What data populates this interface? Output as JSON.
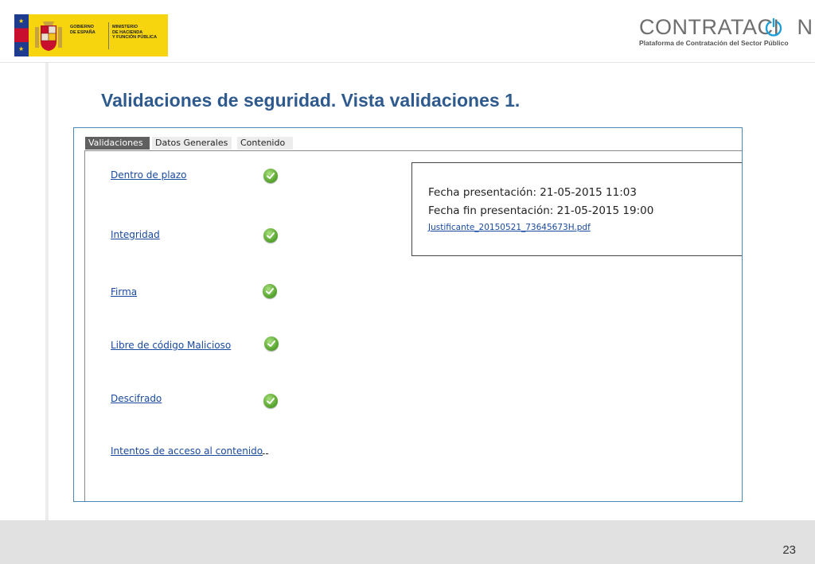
{
  "header": {
    "gov_logo": {
      "line1": "GOBIERNO",
      "line2": "DE ESPAÑA",
      "ministry1": "MINISTERIO",
      "ministry2": "DE HACIENDA",
      "ministry3": "Y FUNCIÓN PÚBLICA"
    },
    "brand": {
      "word": "CONTRATACI",
      "word_end": "N",
      "subtitle": "Plataforma de Contratación del Sector Público",
      "power_icon_color": "#1fa0d8"
    }
  },
  "page_title": "Validaciones de seguridad. Vista validaciones 1.",
  "tabs": [
    {
      "label": "Validaciones",
      "active": true
    },
    {
      "label": "Datos Generales",
      "active": false
    },
    {
      "label": "Contenido",
      "active": false
    }
  ],
  "validations": [
    {
      "label": "Dentro de plazo",
      "status": "check-icon"
    },
    {
      "label": "Integridad",
      "status": "check-icon"
    },
    {
      "label": "Firma",
      "status": "check-icon"
    },
    {
      "label": "Libre de código Malicioso",
      "status": "check-icon"
    },
    {
      "label": "Descifrado",
      "status": "check-icon"
    },
    {
      "label": "Intentos de acceso al contenido",
      "status_text": "--"
    }
  ],
  "info": {
    "fecha_presentacion": "Fecha presentación: 21-05-2015 11:03",
    "fecha_fin": "Fecha fin presentación: 21-05-2015 19:00",
    "justificante": "Justificante_20150521_73645673H.pdf"
  },
  "footer": {
    "page_number": "23"
  },
  "colors": {
    "title": "#2e5a8e",
    "link": "#1a4aa0",
    "check": "#5ca832",
    "panel_border": "#4b88b8"
  }
}
